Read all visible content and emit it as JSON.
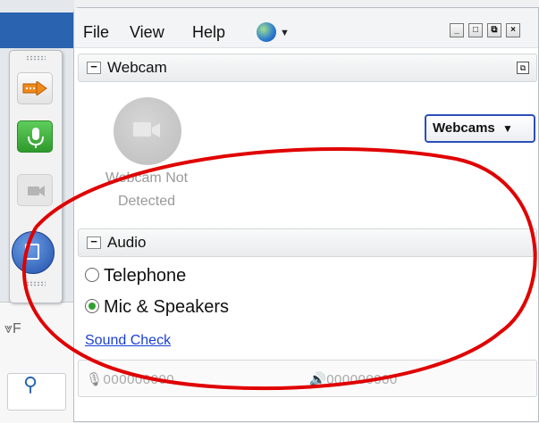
{
  "menu": {
    "file": "File",
    "view": "View",
    "help": "Help",
    "globe_icon": "globe-icon"
  },
  "window_controls": {
    "minimize": "_",
    "maximize": "□",
    "popout": "⧉",
    "close": "×"
  },
  "webcam": {
    "title": "Webcam",
    "collapse": "−",
    "status_line1": "Webcam Not",
    "status_line2": "Detected",
    "dropdown_label": "Webcams",
    "dropdown_caret": "▼"
  },
  "audio": {
    "title": "Audio",
    "collapse": "−",
    "options": [
      {
        "label": "Telephone",
        "selected": false
      },
      {
        "label": "Mic & Speakers",
        "selected": true
      }
    ],
    "sound_check": "Sound Check",
    "mic_meter": "000000000",
    "speaker_meter": "000000000",
    "mic_icon": "🎙",
    "speaker_icon": "🔊"
  },
  "background": {
    "filter_letter": "F"
  },
  "colors": {
    "accent_blue": "#2a63b0",
    "link": "#1a3fd6",
    "annotation": "#e00000",
    "mic_green": "#3aae38"
  }
}
